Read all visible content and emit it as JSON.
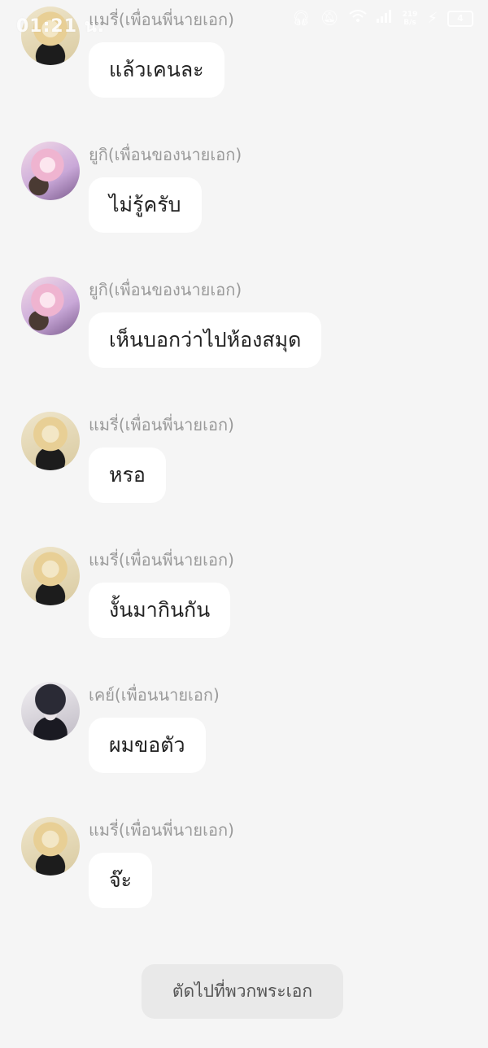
{
  "status_bar": {
    "time": "01:21 น.",
    "net_speed_value": "219",
    "net_speed_unit": "B/s",
    "battery": "4"
  },
  "messages": [
    {
      "sender": "แมรี่(เพื่อนพี่นายเอก)",
      "text": "แล้วเคนละ",
      "avatar": "blonde"
    },
    {
      "sender": "ยูกิ(เพื่อนของนายเอก)",
      "text": "ไม่รู้ครับ",
      "avatar": "pink"
    },
    {
      "sender": "ยูกิ(เพื่อนของนายเอก)",
      "text": "เห็นบอกว่าไปห้องสมุด",
      "avatar": "pink"
    },
    {
      "sender": "แมรี่(เพื่อนพี่นายเอก)",
      "text": "หรอ",
      "avatar": "blonde"
    },
    {
      "sender": "แมรี่(เพื่อนพี่นายเอก)",
      "text": "งั้นมากินกัน",
      "avatar": "blonde"
    },
    {
      "sender": "เคย์(เพื่อนนายเอก)",
      "text": "ผมขอตัว",
      "avatar": "dark"
    },
    {
      "sender": "แมรี่(เพื่อนพี่นายเอก)",
      "text": "จ๊ะ",
      "avatar": "blonde"
    }
  ],
  "skip_button": {
    "label": "ตัดไปที่พวกพระเอก"
  }
}
